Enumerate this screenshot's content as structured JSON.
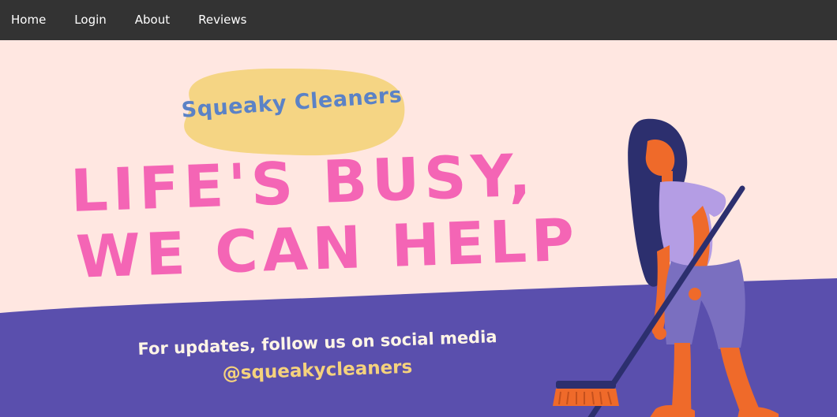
{
  "nav": {
    "items": [
      {
        "label": "Home"
      },
      {
        "label": "Login"
      },
      {
        "label": "About"
      },
      {
        "label": "Reviews"
      }
    ]
  },
  "hero": {
    "brand": "Squeaky Cleaners",
    "headline_line1": "LIFE'S BUSY,",
    "headline_line2": "WE CAN HELP",
    "social_text": "For updates, follow us on social media",
    "handle": "@squeakycleaners"
  },
  "colors": {
    "nav_bg": "#333333",
    "hero_bg": "#ffe7e1",
    "ground": "#5a4fad",
    "headline": "#f465b5",
    "brand_blob": "#f5d584",
    "brand_text": "#5b82c6",
    "handle": "#f5d27d"
  },
  "icons": {
    "illustration": "woman-sweeping-illustration"
  }
}
